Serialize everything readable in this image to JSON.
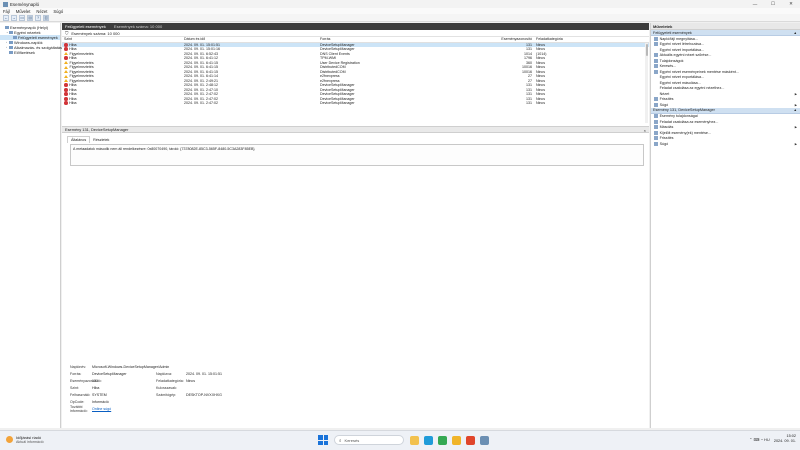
{
  "window": {
    "title": "Eseménynapló"
  },
  "menu": [
    "Fájl",
    "Művelet",
    "Nézet",
    "Súgó"
  ],
  "toolbar": [
    "back-icon",
    "forward-icon",
    "folder-icon",
    "properties-icon",
    "help-icon",
    "panel-icon"
  ],
  "tree": [
    {
      "label": "Eseménynapló (Helyi)",
      "indent": 0,
      "expander": "",
      "selected": false
    },
    {
      "label": "Egyéni nézetek",
      "indent": 1,
      "expander": "⌄",
      "selected": false
    },
    {
      "label": "Felügyeleti események",
      "indent": 2,
      "expander": "",
      "selected": true
    },
    {
      "label": "Windows-naplók",
      "indent": 1,
      "expander": "›",
      "selected": false
    },
    {
      "label": "Alkalmazás- és szolgáltatásnaplók",
      "indent": 1,
      "expander": "›",
      "selected": false
    },
    {
      "label": "Előfizetések",
      "indent": 1,
      "expander": "",
      "selected": false
    }
  ],
  "center": {
    "header_title": "Felügyeleti események",
    "header_sub": "Események száma: 10 000",
    "filter_text": "Események száma: 10 000",
    "columns": {
      "level": "Szint",
      "date": "Dátum és idő",
      "source": "Forrás",
      "id": "Eseményazonosító",
      "category": "Feladatkategória"
    }
  },
  "events": [
    {
      "level": "Hiba",
      "type": "error",
      "date": "2024. 09. 01. 15:01:51",
      "source": "DeviceSetupManager",
      "id": "131",
      "category": "Nincs",
      "selected": true
    },
    {
      "level": "Hiba",
      "type": "error",
      "date": "2024. 09. 01. 15:01:16",
      "source": "DeviceSetupManager",
      "id": "131",
      "category": "Nincs",
      "selected": false
    },
    {
      "level": "Figyelmeztetés",
      "type": "warning",
      "date": "2024. 09. 01. 6:52:43",
      "source": "DNS Client Events",
      "id": "1014",
      "category": "(1014)",
      "selected": false
    },
    {
      "level": "Hiba",
      "type": "error",
      "date": "2024. 09. 01. 6:41:12",
      "source": "TPM-WMI",
      "id": "1796",
      "category": "Nincs",
      "selected": false
    },
    {
      "level": "Figyelmeztetés",
      "type": "warning",
      "date": "2024. 09. 01. 6:41:15",
      "source": "User Device Registration",
      "id": "360",
      "category": "Nincs",
      "selected": false
    },
    {
      "level": "Figyelmeztetés",
      "type": "warning",
      "date": "2024. 09. 01. 6:41:15",
      "source": "DistributedCOM",
      "id": "10016",
      "category": "Nincs",
      "selected": false
    },
    {
      "level": "Figyelmeztetés",
      "type": "warning",
      "date": "2024. 09. 01. 6:41:15",
      "source": "DistributedCOM",
      "id": "10016",
      "category": "Nincs",
      "selected": false
    },
    {
      "level": "Figyelmeztetés",
      "type": "warning",
      "date": "2024. 09. 01. 6:41:14",
      "source": "e2fnexpress",
      "id": "27",
      "category": "Nincs",
      "selected": false
    },
    {
      "level": "Figyelmeztetés",
      "type": "warning",
      "date": "2024. 09. 01. 2:49:21",
      "source": "e2fnexpress",
      "id": "27",
      "category": "Nincs",
      "selected": false
    },
    {
      "level": "Hiba",
      "type": "error",
      "date": "2024. 09. 01. 2:48:12",
      "source": "DeviceSetupManager",
      "id": "131",
      "category": "Nincs",
      "selected": false
    },
    {
      "level": "Hiba",
      "type": "error",
      "date": "2024. 09. 01. 2:47:10",
      "source": "DeviceSetupManager",
      "id": "131",
      "category": "Nincs",
      "selected": false
    },
    {
      "level": "Hiba",
      "type": "error",
      "date": "2024. 09. 01. 2:47:02",
      "source": "DeviceSetupManager",
      "id": "131",
      "category": "Nincs",
      "selected": false
    },
    {
      "level": "Hiba",
      "type": "error",
      "date": "2024. 09. 01. 2:47:02",
      "source": "DeviceSetupManager",
      "id": "131",
      "category": "Nincs",
      "selected": false
    },
    {
      "level": "Hiba",
      "type": "error",
      "date": "2024. 09. 01. 2:47:02",
      "source": "DeviceSetupManager",
      "id": "131",
      "category": "Nincs",
      "selected": false
    }
  ],
  "detail": {
    "title": "Esemény 131, DeviceSetupManager",
    "close": "×",
    "tab_general": "Általános",
    "tab_details": "Részletek",
    "message": "A metaadatok második nem áll rendelkezésre: 0x80070490, tároló: {7378082E-85C3-565F-8480-5C3A283F85EB}",
    "labels": {
      "log_name": "Naplónév:",
      "source": "Forrás:",
      "event_id": "Eseményazonosító:",
      "level": "Szint:",
      "user": "Felhasználó:",
      "opcode": "OpCode:",
      "more_info": "További információ:",
      "logged": "Naplózva:",
      "task_category": "Feladatkategória:",
      "keywords": "Kulcsszavak:",
      "computer": "Számítógép:"
    },
    "values": {
      "log_name": "Microsoft-Windows-DeviceSetupManager/Admin",
      "source": "DeviceSetupManager",
      "event_id": "131",
      "level": "Hiba",
      "user": "SYSTEM",
      "opcode": "Információ",
      "more_info": "Online súgó",
      "logged": "2024. 09. 01. 15:01:51",
      "task_category": "Nincs",
      "keywords": "",
      "computer": "DESKTOP-NVXXHXG"
    }
  },
  "actions": {
    "header": "Műveletek",
    "section1": "Felügyeleti események",
    "items1": [
      {
        "label": "Napló/fájl megnyitása...",
        "icon": true,
        "arrow": false
      },
      {
        "label": "Egyéni nézet létrehozása...",
        "icon": true,
        "arrow": false
      },
      {
        "label": "Egyéni nézet importálása...",
        "icon": false,
        "arrow": false
      },
      {
        "label": "Aktuális egyéni nézet szűrése...",
        "icon": true,
        "arrow": false
      },
      {
        "label": "Tulajdonságok",
        "icon": true,
        "arrow": false
      },
      {
        "label": "Keresés...",
        "icon": true,
        "arrow": false
      },
      {
        "label": "Egyéni nézet eseményeinek mentése másként...",
        "icon": true,
        "arrow": false
      },
      {
        "label": "Egyéni nézet exportálása...",
        "icon": false,
        "arrow": false
      },
      {
        "label": "Egyéni nézet másolása...",
        "icon": false,
        "arrow": false
      },
      {
        "label": "Feladat csatolása az egyéni nézethez...",
        "icon": false,
        "arrow": false
      },
      {
        "label": "Nézet",
        "icon": false,
        "arrow": true
      },
      {
        "label": "Frissítés",
        "icon": true,
        "arrow": false
      },
      {
        "label": "Súgó",
        "icon": true,
        "arrow": true
      }
    ],
    "section2": "Esemény 131, DeviceSetupManager",
    "items2": [
      {
        "label": "Esemény tulajdonságai",
        "icon": true,
        "arrow": false
      },
      {
        "label": "Feladat csatolása az eseményhez...",
        "icon": true,
        "arrow": false
      },
      {
        "label": "Másolás",
        "icon": true,
        "arrow": true
      },
      {
        "label": "Kijelölt esemény(ek) mentése...",
        "icon": true,
        "arrow": false
      },
      {
        "label": "Frissítés",
        "icon": true,
        "arrow": false
      },
      {
        "label": "Súgó",
        "icon": true,
        "arrow": true
      }
    ]
  },
  "taskbar": {
    "weather_title": "Időjárási riadó",
    "weather_sub": "Aktuál információ",
    "search_placeholder": "Keresés",
    "apps": [
      {
        "name": "explorer-icon",
        "color": "#f2c14e"
      },
      {
        "name": "edge-icon",
        "color": "#1f9bd9"
      },
      {
        "name": "chrome-icon",
        "color": "#34a853"
      },
      {
        "name": "folder-icon",
        "color": "#f0b429"
      },
      {
        "name": "brave-icon",
        "color": "#e0452b"
      },
      {
        "name": "eventviewer-icon",
        "color": "#6b8fb3"
      }
    ],
    "tray": "⌃  ⌨  ◔  HU",
    "time": "15:02",
    "date": "2024. 09. 01."
  }
}
